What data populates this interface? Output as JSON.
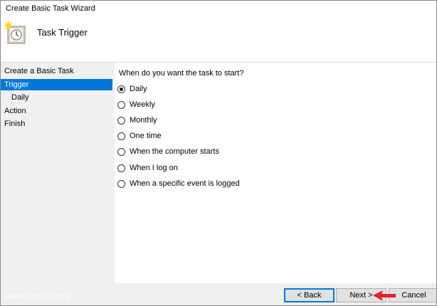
{
  "window": {
    "title": "Create Basic Task Wizard"
  },
  "header": {
    "title": "Task Trigger",
    "icon": "clock-icon"
  },
  "sidebar": {
    "items": [
      {
        "label": "Create a Basic Task",
        "active": false,
        "sub": false
      },
      {
        "label": "Trigger",
        "active": true,
        "sub": false
      },
      {
        "label": "Daily",
        "active": false,
        "sub": true
      },
      {
        "label": "Action",
        "active": false,
        "sub": false
      },
      {
        "label": "Finish",
        "active": false,
        "sub": false
      }
    ]
  },
  "main": {
    "question": "When do you want the task to start?",
    "options": [
      {
        "label": "Daily",
        "checked": true
      },
      {
        "label": "Weekly",
        "checked": false
      },
      {
        "label": "Monthly",
        "checked": false
      },
      {
        "label": "One time",
        "checked": false
      },
      {
        "label": "When the computer starts",
        "checked": false
      },
      {
        "label": "When I log on",
        "checked": false
      },
      {
        "label": "When a specific event is logged",
        "checked": false
      }
    ]
  },
  "footer": {
    "back_label": "< Back",
    "next_label": "Next >",
    "cancel_label": "Cancel"
  },
  "watermark": "www.wintips.org",
  "colors": {
    "accent": "#0078d7",
    "arrow": "#e0202a"
  }
}
